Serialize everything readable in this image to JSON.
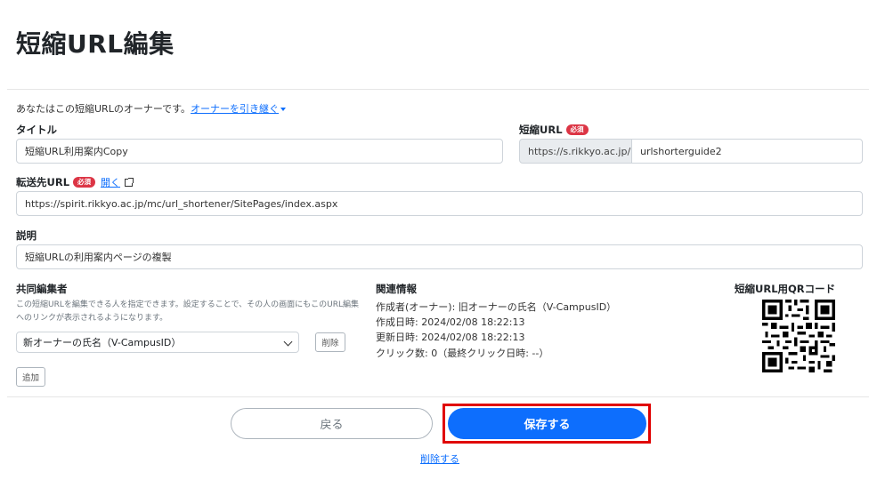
{
  "page_title": "短縮URL編集",
  "owner_note": {
    "text": "あなたはこの短縮URLのオーナーです。",
    "transfer_link": "オーナーを引き継ぐ"
  },
  "required_badge": "必須",
  "title_field": {
    "label": "タイトル",
    "value": "短縮URL利用案内Copy"
  },
  "short_url_field": {
    "label": "短縮URL",
    "prefix": "https://s.rikkyo.ac.jp/",
    "value": "urlshorterguide2"
  },
  "redirect_field": {
    "label": "転送先URL",
    "open_link": "開く",
    "value": "https://spirit.rikkyo.ac.jp/mc/url_shortener/SitePages/index.aspx"
  },
  "description_field": {
    "label": "説明",
    "value": "短縮URLの利用案内ページの複製"
  },
  "co_editors": {
    "label": "共同編集者",
    "help": "この短縮URLを編集できる人を指定できます。設定することで、その人の画面にもこのURL編集へのリンクが表示されるようになります。",
    "selected": "新オーナーの氏名（V-CampusID）",
    "remove_label": "削除",
    "add_label": "追加"
  },
  "related_info": {
    "label": "関連情報",
    "creator": "作成者(オーナー): 旧オーナーの氏名（V-CampusID）",
    "created": "作成日時: 2024/02/08 18:22:13",
    "updated": "更新日時: 2024/02/08 18:22:13",
    "clicks": "クリック数: 0（最終クリック日時: --）"
  },
  "qr": {
    "label": "短縮URL用QRコード",
    "icon": "qr-code-icon"
  },
  "buttons": {
    "back": "戻る",
    "save": "保存する",
    "delete": "削除する"
  },
  "colors": {
    "primary": "#0d6efd",
    "badge": "#dc3545",
    "highlight": "#e00000"
  }
}
